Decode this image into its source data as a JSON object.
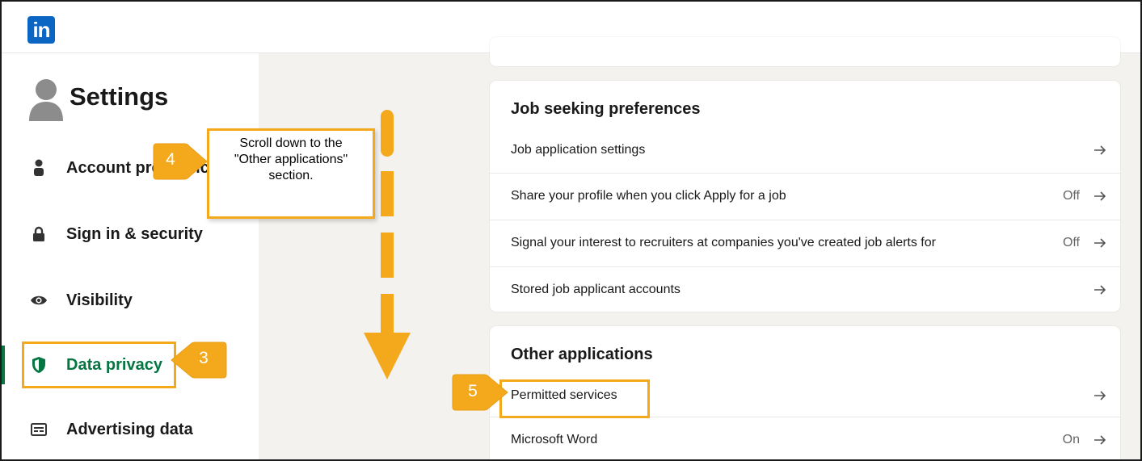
{
  "brand": {
    "logo_text": "in",
    "brand_color": "#0a66c2"
  },
  "sidebar": {
    "title": "Settings",
    "items": [
      {
        "label": "Account preferences",
        "icon": "person-icon",
        "active": false
      },
      {
        "label": "Sign in & security",
        "icon": "lock-icon",
        "active": false
      },
      {
        "label": "Visibility",
        "icon": "eye-icon",
        "active": false
      },
      {
        "label": "Data privacy",
        "icon": "shield-icon",
        "active": true
      },
      {
        "label": "Advertising data",
        "icon": "ad-icon",
        "active": false
      }
    ],
    "active_color": "#057642"
  },
  "main": {
    "job_section": {
      "title": "Job seeking preferences",
      "rows": [
        {
          "label": "Job application settings",
          "status": ""
        },
        {
          "label": "Share your profile when you click Apply for a job",
          "status": "Off"
        },
        {
          "label": "Signal your interest to recruiters at companies you've created job alerts for",
          "status": "Off"
        },
        {
          "label": "Stored job applicant accounts",
          "status": ""
        }
      ]
    },
    "other_section": {
      "title": "Other applications",
      "rows": [
        {
          "label": "Permitted services",
          "status": ""
        },
        {
          "label": "Microsoft Word",
          "status": "On"
        }
      ]
    }
  },
  "annotations": {
    "step3": "3",
    "step4": "4",
    "step5": "5",
    "note_line1": "Scroll down to the",
    "note_line2": "\"Other applications\"",
    "note_line3": "section.",
    "highlight_color": "#f4a91d"
  }
}
